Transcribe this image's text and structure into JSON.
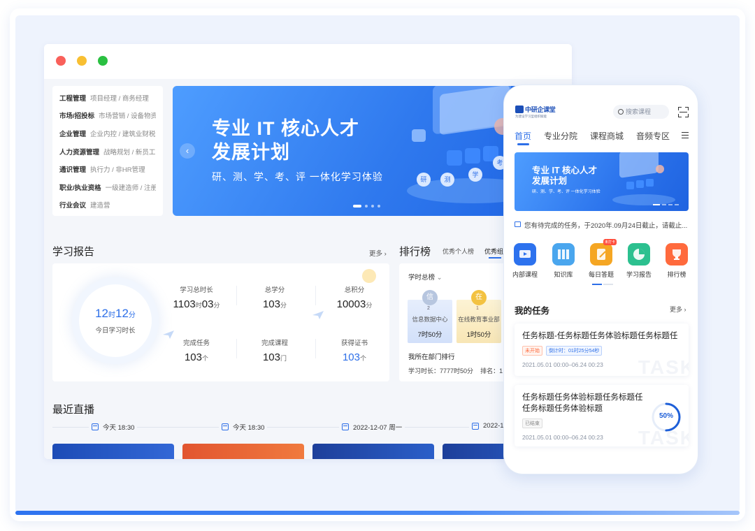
{
  "menu": [
    {
      "main": "工程管理",
      "sub": "项目经理 / 商务经理"
    },
    {
      "main": "市场/招投标",
      "sub": "市场营销 / 设备物资"
    },
    {
      "main": "企业管理",
      "sub": "企业内控 / 建筑业财税"
    },
    {
      "main": "人力资源管理",
      "sub": "战略规划 / 新员工..."
    },
    {
      "main": "通识管理",
      "sub": "执行力 / 非HR管理"
    },
    {
      "main": "职业/执业资格",
      "sub": "一级建造师 / 注册..."
    },
    {
      "main": "行业会议",
      "sub": "建造营"
    }
  ],
  "banner": {
    "title_line1": "专业 IT 核心人才",
    "title_line2": "发展计划",
    "subtitle": "研、测、学、考、评 一体化学习体验",
    "bubbles": [
      "研",
      "测",
      "学",
      "考"
    ]
  },
  "report": {
    "title": "学习报告",
    "more": "更多",
    "today": {
      "h": "12",
      "h_unit": "时",
      "m": "12",
      "m_unit": "分",
      "label": "今日学习时长"
    },
    "stats": [
      {
        "label": "学习总时长",
        "v1": "1103",
        "u1": "时",
        "v2": "03",
        "u2": "分"
      },
      {
        "label": "总学分",
        "v1": "103",
        "u1": "分"
      },
      {
        "label": "总积分",
        "v1": "10003",
        "u1": "分"
      },
      {
        "label": "完成任务",
        "v1": "103",
        "u1": "个"
      },
      {
        "label": "完成课程",
        "v1": "103",
        "u1": "门"
      },
      {
        "label": "获得证书",
        "v1": "103",
        "u1": "个"
      }
    ]
  },
  "ranking": {
    "title": "排行榜",
    "tab1": "优秀个人榜",
    "tab2": "优秀组织",
    "filter": "学时总榜",
    "cards": [
      {
        "rank": "2",
        "medal": "信",
        "name": "信息数据中心",
        "time": "7时50分"
      },
      {
        "rank": "1",
        "medal": "在",
        "name": "在线教育事业部",
        "time": "1时50分"
      }
    ],
    "dept": "我所在部门排行",
    "dept_time": "学习时长：7777时50分",
    "dept_rank": "排名：1"
  },
  "live": {
    "title": "最近直播",
    "items": [
      "今天 18:30",
      "今天 18:30",
      "2022-12-07 周一",
      "2022-1"
    ]
  },
  "phone": {
    "logo_name": "中研企课堂",
    "logo_slogan": "为建设学习型组织赋能",
    "search_placeholder": "搜索课程",
    "nav": [
      "首页",
      "专业分院",
      "课程商城",
      "音频专区"
    ],
    "banner": {
      "title_line1": "专业 IT 核心人才",
      "title_line2": "发展计划",
      "subtitle": "研、测、学、考、评 一体化学习体验"
    },
    "notice": "您有待完成的任务，于2020年.09月24日截止，请截止...",
    "icons": [
      {
        "label": "内部课程",
        "color": "#2d72ee"
      },
      {
        "label": "知识库",
        "color": "#4aa6ee"
      },
      {
        "label": "每日答题",
        "color": "#f5a623",
        "tag": "未打卡"
      },
      {
        "label": "学习报告",
        "color": "#2cc08f"
      },
      {
        "label": "排行榜",
        "color": "#ff6a3d"
      }
    ],
    "tasks_title": "我的任务",
    "tasks_more": "更多",
    "tasks": [
      {
        "title": "任务标题-任务标题任务体验标题任务标题任",
        "status": "未开始",
        "countdown": "倒计时：01时25分54秒",
        "date": "2021.05.01 00:00–06.24 00:23",
        "watermark": "TASK"
      },
      {
        "title_l1": "任务标题任务体验标题任务标题任",
        "title_l2": "任务标题任务体验标题",
        "status": "已结束",
        "date": "2021.05.01 00:00–06.24 00:23",
        "progress": "50%",
        "progress_value": 0.5,
        "watermark": "TASK"
      }
    ]
  }
}
